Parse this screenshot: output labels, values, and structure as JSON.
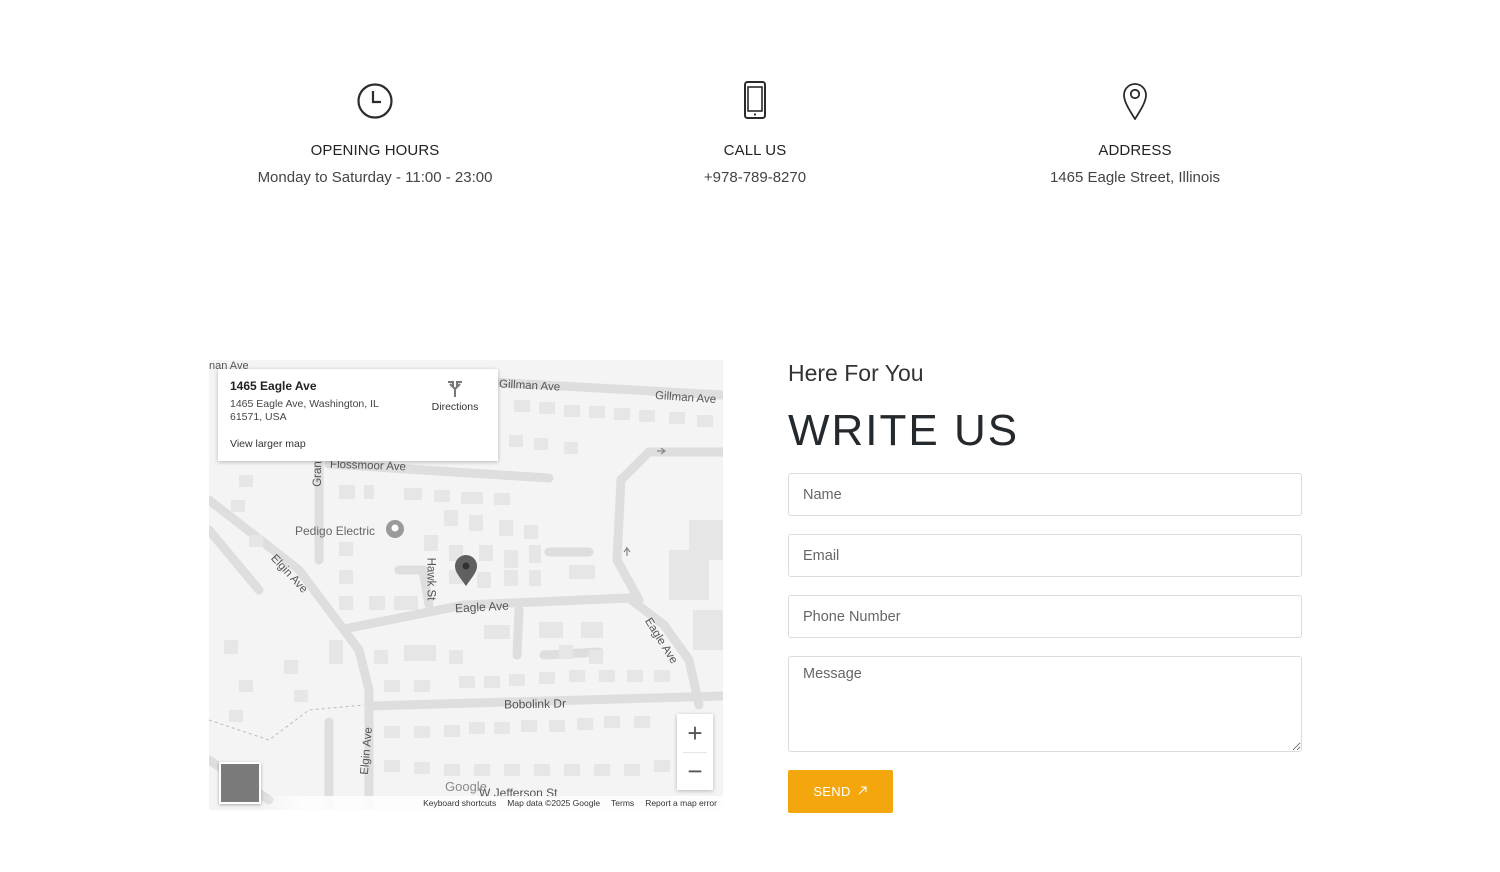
{
  "info": [
    {
      "icon": "clock-icon",
      "title": "OPENING HOURS",
      "text": "Monday to Saturday - 11:00 - 23:00"
    },
    {
      "icon": "phone-icon",
      "title": "CALL US",
      "text": "+978-789-8270"
    },
    {
      "icon": "map-pin-icon",
      "title": "ADDRESS",
      "text": "1465 Eagle Street, Illinois"
    }
  ],
  "map": {
    "place_name": "1465 Eagle Ave",
    "place_address": "1465 Eagle Ave, Washington, IL 61571, USA",
    "directions_label": "Directions",
    "view_larger": "View larger map",
    "streets": {
      "gillman1": "Gillman Ave",
      "gillman2": "Gillman Ave",
      "flossmoor": "Flossmoor Ave",
      "grant": "Gran",
      "pedigo": "Pedigo Electric",
      "elgin1": "Elgin Ave",
      "hawk": "Hawk St",
      "eagle1": "Eagle Ave",
      "eagle2": "Eagle Ave",
      "bobolink": "Bobolink Dr",
      "elgin2": "Elgin Ave",
      "jefferson": "W Jefferson St",
      "nan": "nan Ave"
    },
    "google_logo": "Google",
    "attribution": {
      "shortcuts": "Keyboard shortcuts",
      "data": "Map data ©2025 Google",
      "terms": "Terms",
      "report": "Report a map error"
    },
    "zoom_in": "+",
    "zoom_out": "−"
  },
  "form": {
    "kicker": "Here For You",
    "headline": "WRITE US",
    "name_placeholder": "Name",
    "email_placeholder": "Email",
    "phone_placeholder": "Phone Number",
    "message_placeholder": "Message",
    "send_label": "SEND",
    "accent": "#f4a70d"
  }
}
